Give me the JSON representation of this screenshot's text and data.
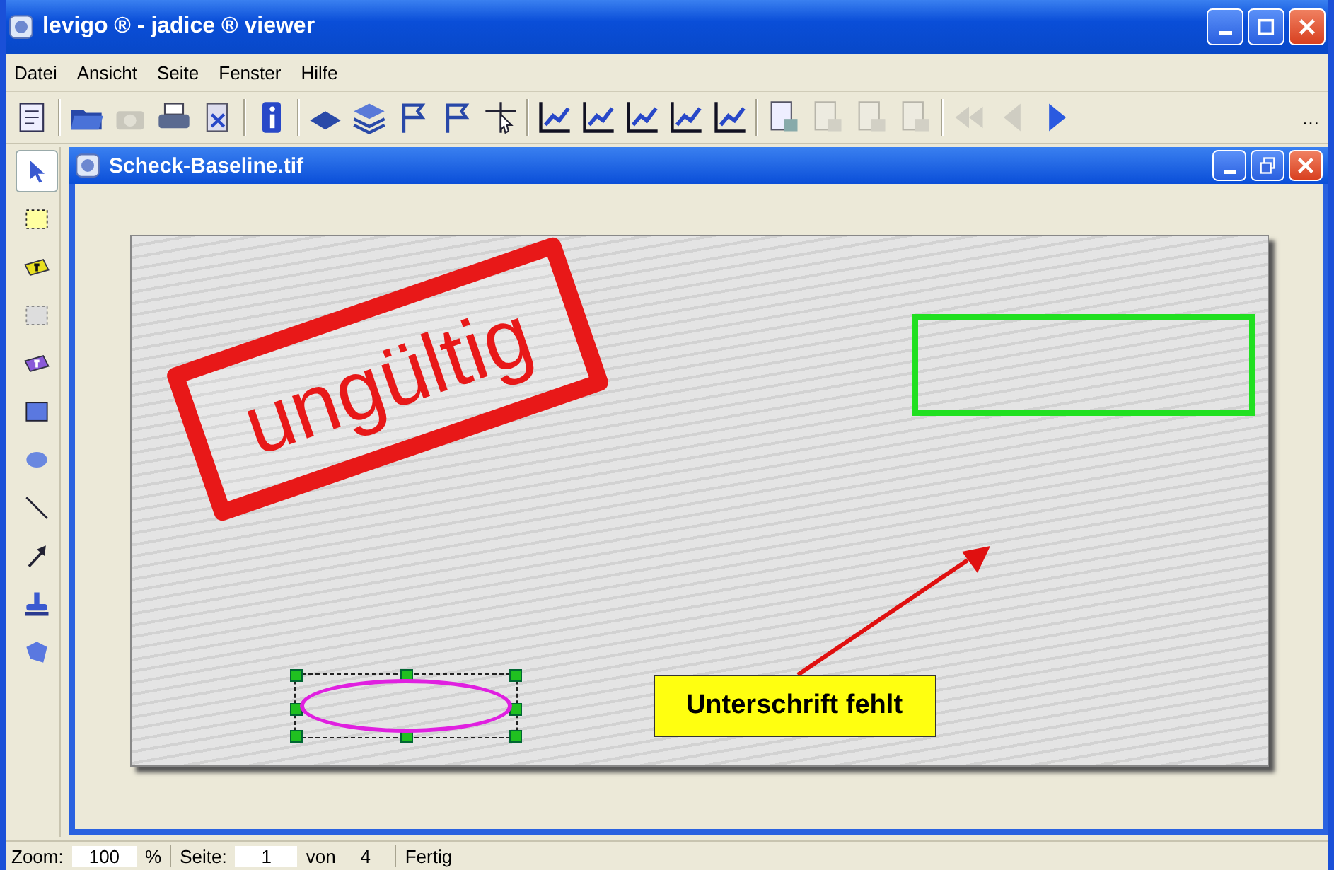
{
  "window": {
    "title": "levigo ® - jadice ® viewer"
  },
  "menu": [
    "Datei",
    "Ansicht",
    "Seite",
    "Fenster",
    "Hilfe"
  ],
  "toolbar": [
    {
      "kind": "properties",
      "disabled": false
    },
    {
      "kind": "separator"
    },
    {
      "kind": "folder",
      "disabled": false
    },
    {
      "kind": "camera",
      "disabled": true
    },
    {
      "kind": "printer",
      "disabled": false
    },
    {
      "kind": "export",
      "disabled": false
    },
    {
      "kind": "separator"
    },
    {
      "kind": "info",
      "disabled": false
    },
    {
      "kind": "separator"
    },
    {
      "kind": "sheet",
      "disabled": false
    },
    {
      "kind": "layers",
      "disabled": false
    },
    {
      "kind": "flag",
      "disabled": false
    },
    {
      "kind": "flag",
      "disabled": false
    },
    {
      "kind": "crosshair",
      "disabled": false
    },
    {
      "kind": "separator"
    },
    {
      "kind": "chart",
      "disabled": false
    },
    {
      "kind": "chart",
      "disabled": false
    },
    {
      "kind": "chart",
      "disabled": false
    },
    {
      "kind": "chart",
      "disabled": false
    },
    {
      "kind": "chart",
      "disabled": false
    },
    {
      "kind": "separator"
    },
    {
      "kind": "page",
      "disabled": false
    },
    {
      "kind": "page",
      "disabled": true
    },
    {
      "kind": "page",
      "disabled": true
    },
    {
      "kind": "page",
      "disabled": true
    },
    {
      "kind": "separator"
    },
    {
      "kind": "rewind",
      "disabled": true
    },
    {
      "kind": "back",
      "disabled": true
    },
    {
      "kind": "play",
      "disabled": false
    }
  ],
  "toolbar_overflow": "…",
  "tools": [
    {
      "kind": "pointer",
      "selected": true
    },
    {
      "kind": "marquee",
      "selected": false
    },
    {
      "kind": "note",
      "selected": false
    },
    {
      "kind": "hatch",
      "selected": false
    },
    {
      "kind": "stamp-note",
      "selected": false
    },
    {
      "kind": "rectangle",
      "selected": false
    },
    {
      "kind": "ellipse",
      "selected": false
    },
    {
      "kind": "line",
      "selected": false
    },
    {
      "kind": "arrow",
      "selected": false
    },
    {
      "kind": "stamp",
      "selected": false
    },
    {
      "kind": "polygon",
      "selected": false
    }
  ],
  "document": {
    "title": "Scheck-Baseline.tif",
    "annotations": [
      {
        "kind": "stamp",
        "text": "ungültig",
        "selected": false
      },
      {
        "kind": "rectangle",
        "selected": false
      },
      {
        "kind": "arrow",
        "selected": false
      },
      {
        "kind": "textbox",
        "text": "Unterschrift fehlt",
        "selected": false
      },
      {
        "kind": "ellipse",
        "selected": true
      }
    ]
  },
  "status_bar": {
    "zoom_label": "Zoom:",
    "zoom": "100",
    "zoom_unit": "%",
    "page_label": "Seite:",
    "page": "1",
    "of": "von",
    "pages": "4",
    "message": "Fertig"
  }
}
